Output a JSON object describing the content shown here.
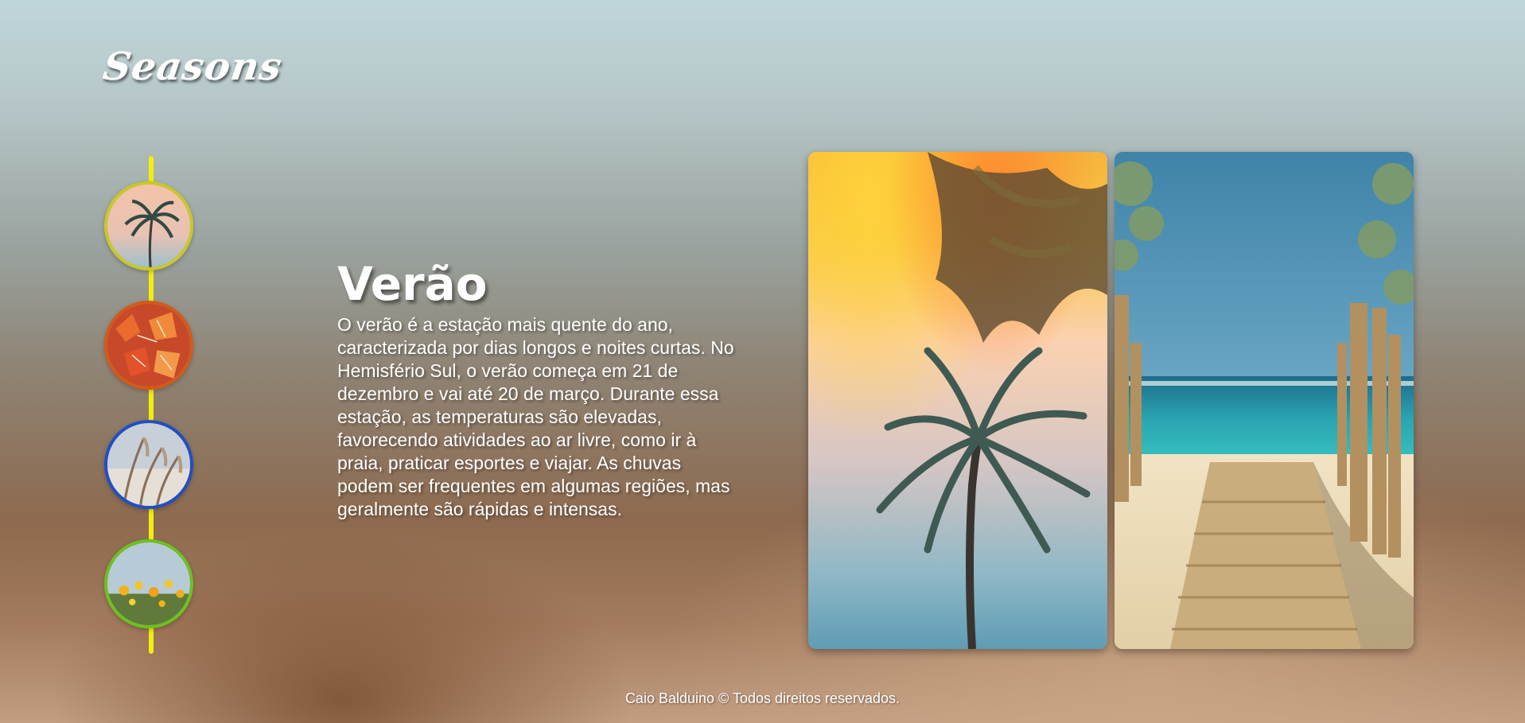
{
  "app": {
    "logo": "Seasons"
  },
  "timeline": {
    "items": [
      {
        "season": "summer",
        "icon": "palm-tree-thumbnail",
        "border_color": "#c9c826"
      },
      {
        "season": "autumn",
        "icon": "autumn-leaves-thumbnail",
        "border_color": "#d45a18"
      },
      {
        "season": "winter",
        "icon": "winter-grass-thumbnail",
        "border_color": "#1f4fc4"
      },
      {
        "season": "spring",
        "icon": "spring-flowers-thumbnail",
        "border_color": "#6cc21e"
      }
    ],
    "line_color": "#f2ee0c"
  },
  "main": {
    "title": "Verão",
    "description": "O verão é a estação mais quente do ano, caracterizada por dias longos e noites curtas. No Hemisfério Sul, o verão começa em 21 de dezembro e vai até 20 de março. Durante essa estação, as temperaturas são elevadas, favorecendo atividades ao ar livre, como ir à praia, praticar esportes e viajar. As chuvas podem ser frequentes em algumas regiões, mas geralmente são rápidas e intensas."
  },
  "gallery": {
    "images": [
      {
        "icon": "palm-tree-sunset-photo"
      },
      {
        "icon": "beach-boardwalk-photo"
      }
    ]
  },
  "footer": {
    "text": "Caio Balduino © Todos direitos reservados."
  }
}
